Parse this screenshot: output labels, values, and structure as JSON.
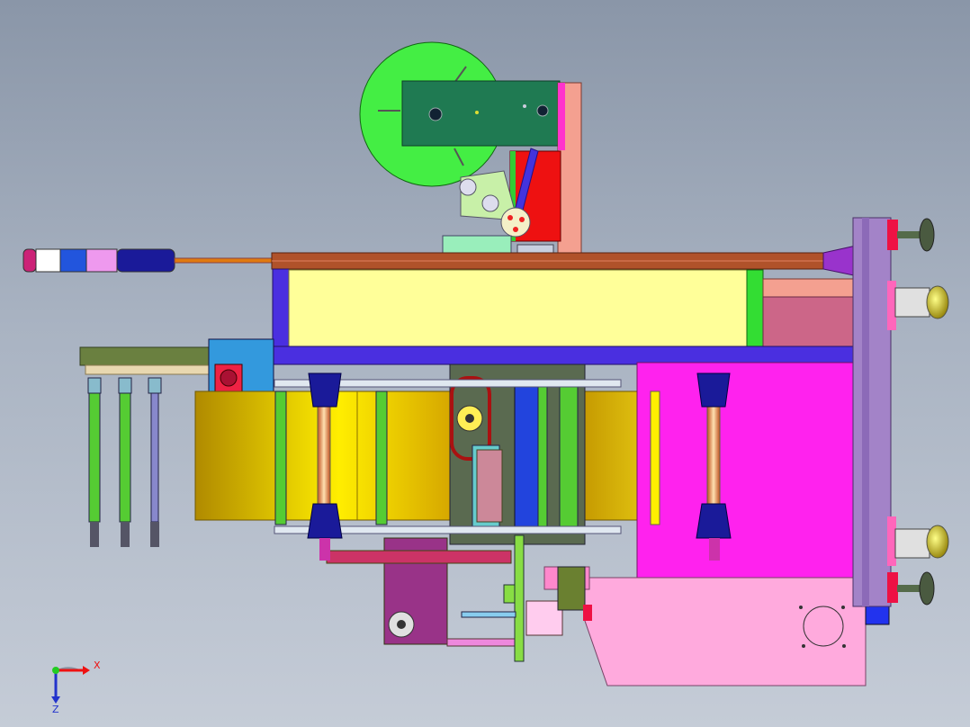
{
  "view": {
    "triad": {
      "x_label": "X",
      "z_label": "Z"
    }
  },
  "colors": {
    "background_top": "#8a96a8",
    "background_bottom": "#c5ccd7",
    "reel": "#44ee44",
    "label_band": "#ffff99",
    "roll_gold": "#d4a400",
    "frame_purple": "#4a2fe0",
    "frame_brown": "#b0522a",
    "magenta": "#ff22ee",
    "pink_panel": "#ffaadd",
    "green_plate": "#1f7a52",
    "red_block": "#ee1111",
    "right_rail": "#a383c8"
  },
  "signal_tower_colors": [
    "#cc2277",
    "#ffffff",
    "#2255dd",
    "#ee99ee",
    "#1a1a99"
  ]
}
